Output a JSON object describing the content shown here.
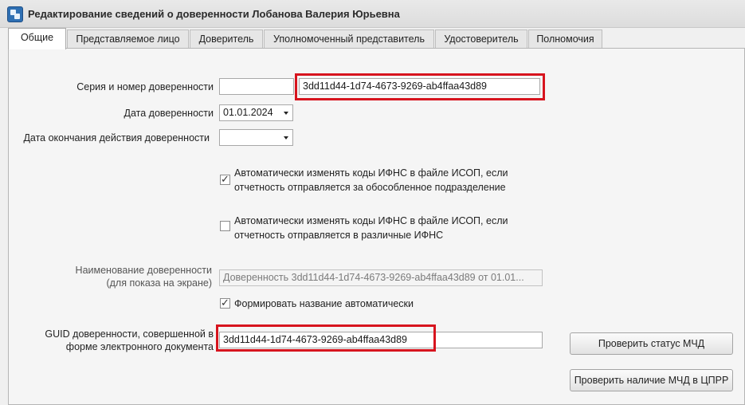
{
  "window": {
    "title": "Редактирование сведений о доверенности Лобанова Валерия Юрьевна"
  },
  "tabs": [
    {
      "label": "Общие",
      "active": true
    },
    {
      "label": "Представляемое лицо",
      "active": false
    },
    {
      "label": "Доверитель",
      "active": false
    },
    {
      "label": "Уполномоченный представитель",
      "active": false
    },
    {
      "label": "Удостоверитель",
      "active": false
    },
    {
      "label": "Полномочия",
      "active": false
    }
  ],
  "form": {
    "series_number_label": "Серия и номер доверенности",
    "series_value": "",
    "number_value": "3dd11d44-1d74-4673-9269-ab4ffaa43d89",
    "date_label": "Дата доверенности",
    "date_value": "01.01.2024",
    "end_date_label": "Дата окончания действия доверенности",
    "end_date_value": "",
    "checkbox_separate": {
      "checked": true,
      "line1": "Автоматически изменять коды ИФНС в файле ИСОП, если",
      "line2": "отчетность отправляется за обособленное подразделение"
    },
    "checkbox_various": {
      "checked": false,
      "line1": "Автоматически изменять коды ИФНС в файле ИСОП, если",
      "line2": "отчетность отправляется в различные ИФНС"
    },
    "display_name_label_line1": "Наименование доверенности",
    "display_name_label_line2": "(для показа на экране)",
    "display_name_value": "Доверенность  3dd11d44-1d74-4673-9269-ab4ffaa43d89 от 01.01...",
    "checkbox_auto_name": {
      "checked": true,
      "label": "Формировать название автоматически"
    },
    "guid_label_line1": "GUID доверенности, совершенной в",
    "guid_label_line2": "форме электронного документа",
    "guid_value": "3dd11d44-1d74-4673-9269-ab4ffaa43d89"
  },
  "buttons": {
    "check_status": "Проверить статус МЧД",
    "check_registry": "Проверить наличие МЧД в ЦПРР"
  },
  "colors": {
    "highlight": "#d7141e",
    "app_icon": "#2e6fb3"
  },
  "icons": {
    "app": "app-logo-icon",
    "dropdown": "chevron-down-icon",
    "check": "checkmark-icon"
  }
}
